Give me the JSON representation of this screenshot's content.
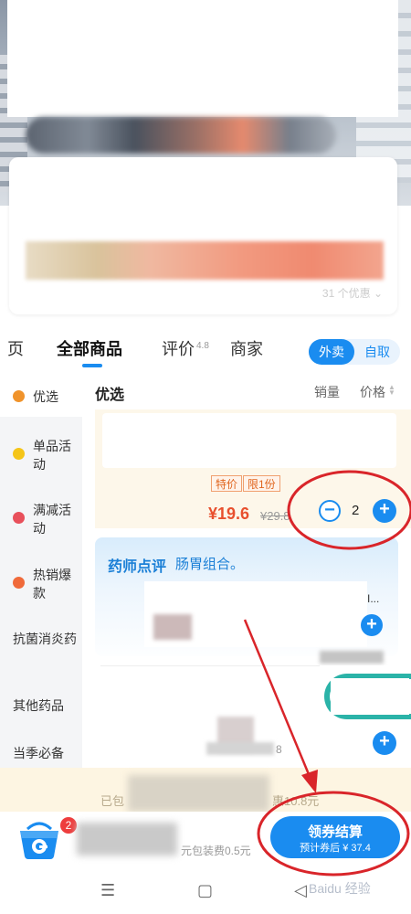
{
  "tabs": {
    "cut_left": "页",
    "all_products": "全部商品",
    "reviews": "评价",
    "rating": "4.8",
    "merchant": "商家"
  },
  "mode_toggle": {
    "delivery": "外卖",
    "pickup": "自取"
  },
  "sidebar": {
    "items": [
      {
        "label": "优选",
        "icon": "heart-badge-icon",
        "color": "#f0932b"
      },
      {
        "label": "单品活动",
        "icon": "tag-badge-icon",
        "color": "#f5c518"
      },
      {
        "label": "满减活动",
        "icon": "discount-badge-icon",
        "color": "#e8505b"
      },
      {
        "label": "热销爆款",
        "icon": "flame-badge-icon",
        "color": "#f06a3a"
      },
      {
        "label": "抗菌消炎药"
      },
      {
        "label": "其他药品"
      },
      {
        "label": "当季必备"
      }
    ]
  },
  "list": {
    "category_title": "优选",
    "sort_sales": "销量",
    "sort_price": "价格"
  },
  "product": {
    "tag_special": "特价",
    "tag_limit": "限1份",
    "price": "¥19.6",
    "original_price": "¥29.8",
    "quantity": "2",
    "minus": "−",
    "plus": "+"
  },
  "pharmacist": {
    "title": "药师点评",
    "desc": "肠胃组合。",
    "ellipsis": "I..."
  },
  "product3": {
    "tail": "8"
  },
  "notice": {
    "left": "已包",
    "right": "惠10.8元"
  },
  "cart": {
    "badge_count": "2",
    "packing_fee": "元包装费0.5元",
    "checkout_label": "领券结算",
    "checkout_sub": "预计券后 ¥ 37.4"
  },
  "system_nav": {
    "menu": "☰",
    "home": "▢",
    "back": "◁"
  },
  "watermark": "Baidu 经验",
  "colors": {
    "accent": "#1a8cf0",
    "price": "#e8502e",
    "annotation": "#d9252a"
  }
}
